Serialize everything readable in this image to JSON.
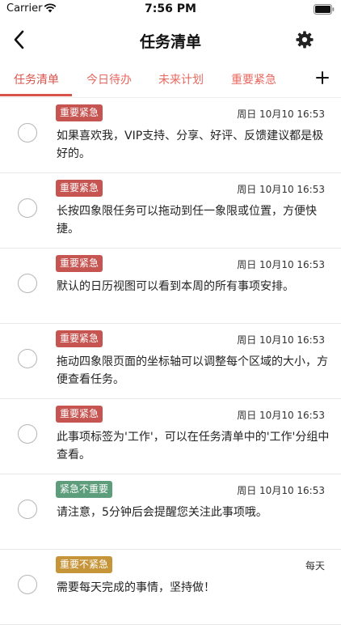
{
  "status": {
    "carrier": "Carrier",
    "time": "7:56 PM"
  },
  "nav": {
    "title": "任务清单"
  },
  "tabs": [
    {
      "label": "任务清单"
    },
    {
      "label": "今日待办"
    },
    {
      "label": "未来计划"
    },
    {
      "label": "重要紧急"
    }
  ],
  "colors": {
    "accent": "#d9534a",
    "badge_urgent_important": "#c65552",
    "badge_urgent_not_important": "#5e9d7b",
    "badge_important_not_urgent": "#c79539"
  },
  "tasks": [
    {
      "badge": "重要紧急",
      "badge_color": "#c65552",
      "date": "周日 10月10 16:53",
      "text": "如果喜欢我，VIP支持、分享、好评、反馈建议都是极好的。"
    },
    {
      "badge": "重要紧急",
      "badge_color": "#c65552",
      "date": "周日 10月10 16:53",
      "text": "长按四象限任务可以拖动到任一象限或位置，方便快捷。"
    },
    {
      "badge": "重要紧急",
      "badge_color": "#c65552",
      "date": "周日 10月10 16:53",
      "text": "默认的日历视图可以看到本周的所有事项安排。"
    },
    {
      "badge": "重要紧急",
      "badge_color": "#c65552",
      "date": "周日 10月10 16:53",
      "text": "拖动四象限页面的坐标轴可以调整每个区域的大小，方便查看任务。"
    },
    {
      "badge": "重要紧急",
      "badge_color": "#c65552",
      "date": "周日 10月10 16:53",
      "text": "此事项标签为'工作'，可以在任务清单中的'工作'分组中查看。"
    },
    {
      "badge": "紧急不重要",
      "badge_color": "#5e9d7b",
      "date": "周日 10月10 16:53",
      "text": "请注意，5分钟后会提醒您关注此事项哦。"
    },
    {
      "badge": "重要不紧急",
      "badge_color": "#c79539",
      "date": "每天",
      "text": "需要每天完成的事情，坚持做！"
    }
  ]
}
